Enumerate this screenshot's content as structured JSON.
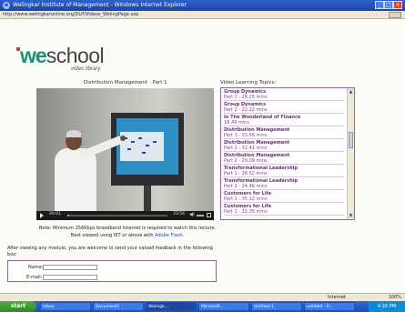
{
  "window": {
    "title": "Welingkar Institute of Management - Windows Internet Explorer"
  },
  "address_bar": {
    "url": "http://www.welingkaronline.org/DLP/Videos_WelingPage.asp"
  },
  "logo": {
    "brand_we": "we",
    "brand_school": "school",
    "subtitle": "video library"
  },
  "video": {
    "title": "Distribution Management - Part 1",
    "current_time": "00:01",
    "total_time": "33:56",
    "progress": 0.02
  },
  "topics": {
    "heading": "Video Learning Topics:",
    "items": [
      {
        "title": "Group Dynamics",
        "part": "Part 1 - 28.25 mins"
      },
      {
        "title": "Group Dynamics",
        "part": "Part 2 - 22.22 mins"
      },
      {
        "title": "In The Wonderland of Finance",
        "part": "18.49 mins"
      },
      {
        "title": "Distribution Management",
        "part": "Part 1 - 33.56 mins"
      },
      {
        "title": "Distribution Management",
        "part": "Part 2 - 32.41 mins"
      },
      {
        "title": "Distribution Management",
        "part": "Part 2 - 29.09 mins"
      },
      {
        "title": "Transformational Leadership",
        "part": "Part 1 - 28.52 mins"
      },
      {
        "title": "Transformational Leadership",
        "part": "Part 2 - 24.46 mins"
      },
      {
        "title": "Customers for Life",
        "part": "Part 1 - 35.12 mins"
      },
      {
        "title": "Customers for Life",
        "part": "Part 2 - 32.35 mins"
      }
    ]
  },
  "note": {
    "line1": "Note: Minimum 256Kbps broadband Internet is required to watch this lecture.",
    "line2_prefix": "Best viewed using IE7 or above with ",
    "flash_link": "Adobe Flash."
  },
  "feedback": {
    "text": "After viewing any module, you are welcome to send your valued feedback in the following box:",
    "name_label": "Name:",
    "email_label": "E-mail:"
  },
  "status_bar": {
    "zone": "Internet",
    "zoom": "100%"
  },
  "taskbar": {
    "start_label": "start",
    "tasks": [
      "Inbox",
      "Document1",
      "Welingk...",
      "Microsoft...",
      "Untitled 1",
      "untitled - P..."
    ],
    "clock": "4:16 PM"
  }
}
